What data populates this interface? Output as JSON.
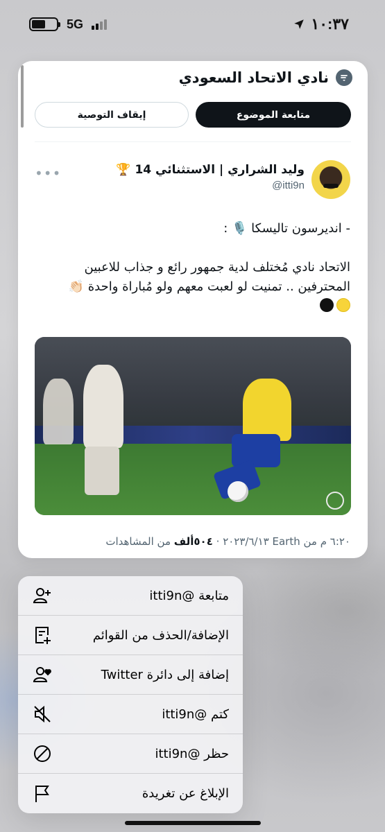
{
  "status_bar": {
    "network": "5G",
    "time": "١٠:٣٧"
  },
  "topic": {
    "title": "نادي الاتحاد السعودي",
    "follow_label": "متابعة الموضوع",
    "stop_recommend_label": "إيقاف التوصية"
  },
  "tweet": {
    "author_name": "وليد الشراري | الاستثنائي 14 🏆",
    "handle": "@itti9n",
    "line1": "- انديرسون تاليسكا 🎙️ :",
    "line2": "الاتحاد نادي مُختلف لدية جمهور رائع و جذاب للاعبين",
    "line3": "المحترفين .. تمنيت لو لعبت معهم ولو مُباراة واحدة 👏🏻",
    "date_meta": "٦:٢٠ م من Earth ‏٢٠٢٣/٦/١٣",
    "views_count": "٥٠٤ألف",
    "views_label": "من المشاهدات"
  },
  "menu": {
    "items": [
      {
        "label": "متابعة @itti9n",
        "icon": "person-plus-icon"
      },
      {
        "label": "الإضافة/الحذف من القوائم",
        "icon": "list-add-icon"
      },
      {
        "label": "إضافة إلى دائرة Twitter",
        "icon": "person-heart-icon"
      },
      {
        "label": "كتم @itti9n",
        "icon": "mute-speaker-icon"
      },
      {
        "label": "حظر @itti9n",
        "icon": "block-icon"
      },
      {
        "label": "الإبلاغ عن تغريدة",
        "icon": "flag-icon"
      }
    ]
  }
}
